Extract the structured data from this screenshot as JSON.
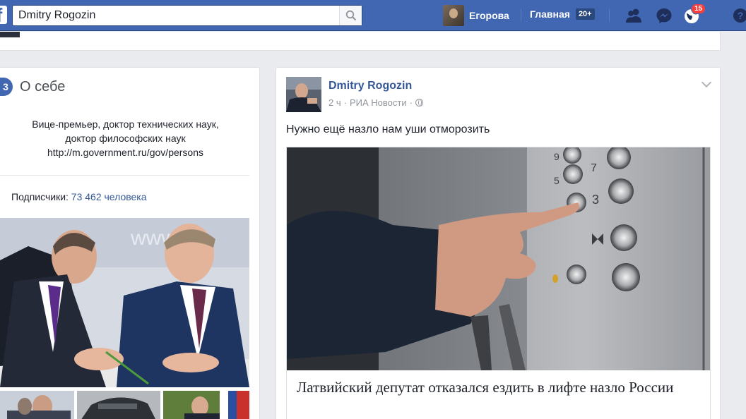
{
  "topbar": {
    "logo": "f",
    "search_value": "Dmitry Rogozin",
    "user_name": "Егорова",
    "home_label": "Главная",
    "home_count": "20+",
    "notifications_count": "15",
    "icons": [
      "friends-icon",
      "messenger-icon",
      "globe-notifications-icon",
      "help-icon"
    ],
    "color_bar": "#4267b2"
  },
  "about": {
    "icon_glyph": "3",
    "title": "О себе",
    "description_lines": [
      "Вице-премьер, доктор технических наук,",
      "доктор философских наук",
      "http://m.government.ru/gov/persons"
    ],
    "followers_label": "Подписчики:",
    "followers_count": "73 462 человека"
  },
  "post": {
    "author": "Dmitry Rogozin",
    "time": "2 ч",
    "source": "РИА Новости",
    "text": "Нужно ещё назло нам уши отморозить",
    "link_title": "Латвийский депутат отказался ездить в лифте назло России",
    "elevator_digits": [
      "9",
      "7",
      "5",
      "3"
    ]
  }
}
